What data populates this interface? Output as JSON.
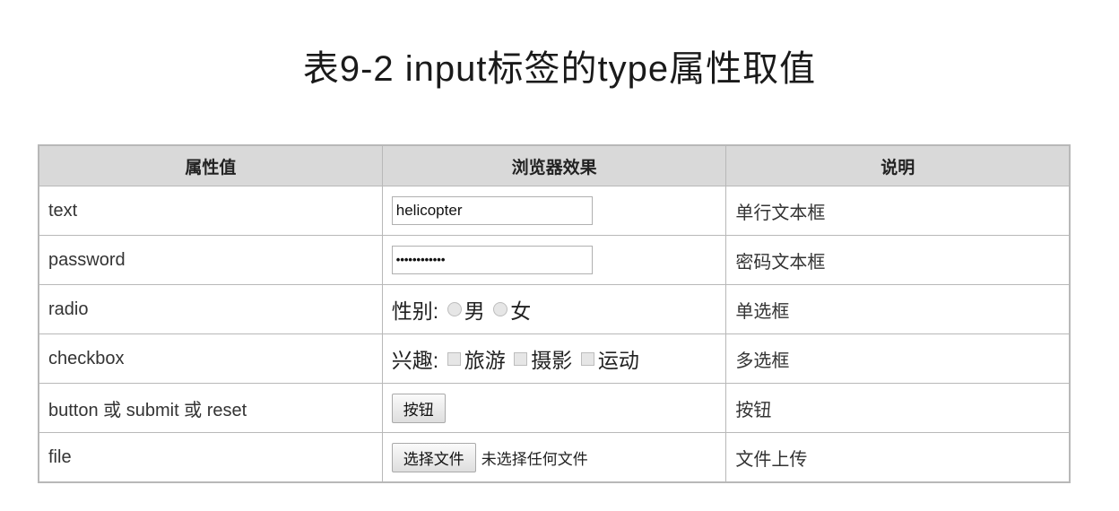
{
  "title": "表9-2  input标签的type属性取值",
  "table": {
    "headers": [
      "属性值",
      "浏览器效果",
      "说明"
    ],
    "rows": {
      "text": {
        "value": "text",
        "input_value": "helicopter",
        "desc": "单行文本框"
      },
      "password": {
        "value": "password",
        "masked_value": "••••••••••••",
        "desc": "密码文本框"
      },
      "radio": {
        "value": "radio",
        "label": "性别:",
        "options": [
          "男",
          "女"
        ],
        "desc": "单选框"
      },
      "checkbox": {
        "value": "checkbox",
        "label": "兴趣:",
        "options": [
          "旅游",
          "摄影",
          "运动"
        ],
        "desc": "多选框"
      },
      "button": {
        "value": "button 或 submit 或 reset",
        "button_label": "按钮",
        "desc": "按钮"
      },
      "file": {
        "value": "file",
        "button_label": "选择文件",
        "status": "未选择任何文件",
        "desc": "文件上传"
      }
    }
  }
}
